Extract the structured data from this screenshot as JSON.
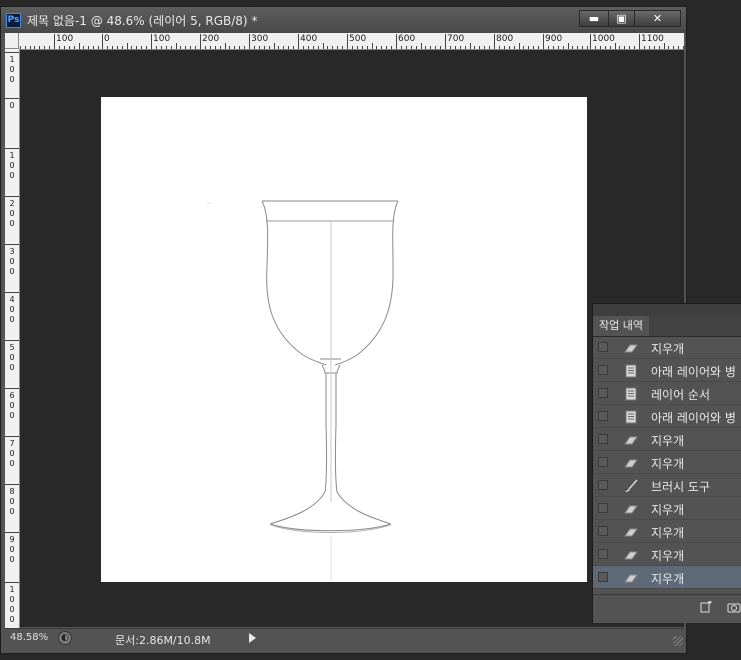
{
  "window": {
    "title": "제목 없음-1 @ 48.6% (레이어 5, RGB/8) *",
    "logo": "Ps",
    "minimize_glyph": "▬",
    "maximize_glyph": "▣",
    "close_glyph": "✕"
  },
  "ruler_top": {
    "labels": [
      "100",
      "0",
      "100",
      "200",
      "300",
      "400",
      "500",
      "600",
      "700",
      "800",
      "900",
      "1000",
      "1100"
    ]
  },
  "ruler_left": {
    "labels": [
      "100",
      "0",
      "100",
      "200",
      "300",
      "400",
      "500",
      "600",
      "700",
      "800",
      "900",
      "1000"
    ]
  },
  "status": {
    "zoom": "48.58%",
    "doc_info": "문서:2.86M/10.8M"
  },
  "history_panel": {
    "tab": "작업 내역",
    "items": [
      {
        "label": "지우개",
        "icon": "eraser-icon"
      },
      {
        "label": "아래 레이어와 병",
        "icon": "document-icon"
      },
      {
        "label": "레이어 순서",
        "icon": "document-icon"
      },
      {
        "label": "아래 레이어와 병",
        "icon": "document-icon"
      },
      {
        "label": "지우개",
        "icon": "eraser-icon"
      },
      {
        "label": "지우개",
        "icon": "eraser-icon"
      },
      {
        "label": "브러시 도구",
        "icon": "brush-icon"
      },
      {
        "label": "지우개",
        "icon": "eraser-icon"
      },
      {
        "label": "지우개",
        "icon": "eraser-icon"
      },
      {
        "label": "지우개",
        "icon": "eraser-icon"
      },
      {
        "label": "지우개",
        "icon": "eraser-icon"
      }
    ],
    "selected_index": 10
  },
  "colors": {
    "window_bg": "#535353",
    "workspace_bg": "#282828",
    "selected_row": "#5f6a79",
    "canvas": "#ffffff"
  }
}
